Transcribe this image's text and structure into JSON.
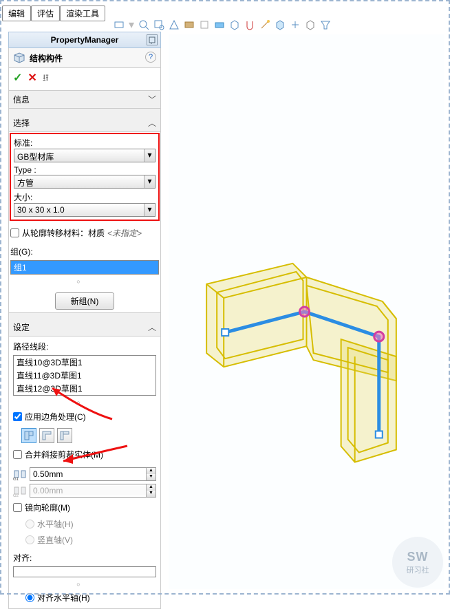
{
  "tabs": {
    "edit": "编辑",
    "eval": "评估",
    "render": "渲染工具"
  },
  "pm": {
    "title": "PropertyManager",
    "feature": "结构构件",
    "help": "?",
    "ok": "✓",
    "cancel": "✕",
    "pin": "✱",
    "info_head": "信息"
  },
  "select": {
    "head": "选择",
    "std_label": "标准:",
    "std_val": "GB型材库",
    "type_label": "Type :",
    "type_val": "方管",
    "size_label": "大小:",
    "size_val": "30 x 30 x 1.0"
  },
  "transfer_mat": {
    "label": "从轮廓转移材料：材质",
    "state": "<未指定>"
  },
  "group": {
    "label": "组(G):",
    "item": "组1",
    "new_group": "新组(N)"
  },
  "settings": {
    "head": "设定",
    "path_label": "路径线段:",
    "segments": [
      "直线10@3D草图1",
      "直线11@3D草图1",
      "直线12@3D草图1"
    ],
    "apply_corner": "应用边角处理(C)",
    "merge_trim": "合并斜接剪裁实体(M)",
    "g1_val": "0.50mm",
    "g2_val": "0.00mm",
    "mirror_profile": "镜向轮廓(M)",
    "hor_axis": "水平轴(H)",
    "ver_axis": "竖直轴(V)",
    "align_label": "对齐:",
    "align_hor": "对齐水平轴(H)"
  },
  "watermark": {
    "sw": "SW",
    "sub": "研习社"
  }
}
